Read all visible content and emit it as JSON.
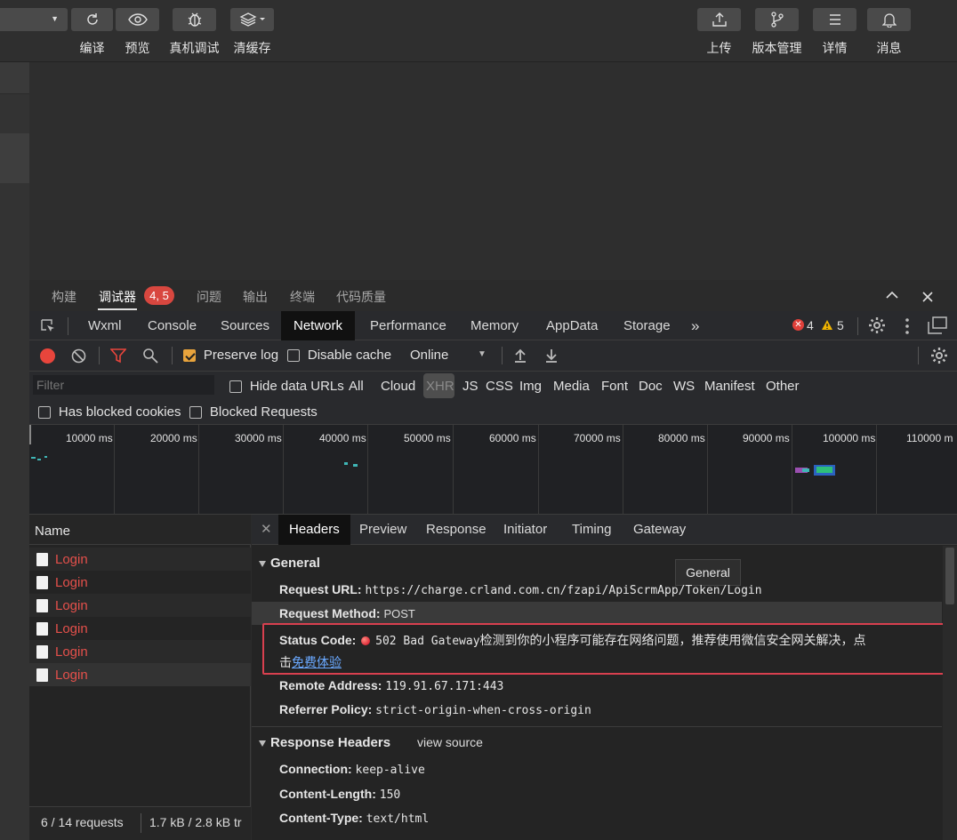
{
  "toolbar": {
    "left_buttons": [
      {
        "label": "编译",
        "icon": "refresh-icon"
      },
      {
        "label": "预览",
        "icon": "eye-icon"
      },
      {
        "label": "真机调试",
        "icon": "bug-icon"
      },
      {
        "label": "清缓存",
        "icon": "layers-icon"
      }
    ],
    "right_buttons": [
      {
        "label": "上传",
        "icon": "upload-icon"
      },
      {
        "label": "版本管理",
        "icon": "branch-icon"
      },
      {
        "label": "详情",
        "icon": "menu-icon"
      },
      {
        "label": "消息",
        "icon": "bell-icon"
      }
    ]
  },
  "debug_tabs": {
    "items": [
      "构建",
      "调试器",
      "问题",
      "输出",
      "终端",
      "代码质量"
    ],
    "active": "调试器",
    "badge": "4, 5"
  },
  "devtools_tabs": {
    "items": [
      "Wxml",
      "Console",
      "Sources",
      "Network",
      "Performance",
      "Memory",
      "AppData",
      "Storage"
    ],
    "active": "Network",
    "more": "»",
    "error_count": "4",
    "warning_count": "5"
  },
  "network_bar": {
    "preserve_log": "Preserve log",
    "disable_cache": "Disable cache",
    "throttle": "Online"
  },
  "filter": {
    "placeholder": "Filter",
    "hide_data_urls": "Hide data URLs",
    "types": [
      "All",
      "Cloud",
      "XHR",
      "JS",
      "CSS",
      "Img",
      "Media",
      "Font",
      "Doc",
      "WS",
      "Manifest",
      "Other"
    ],
    "active_type": "XHR",
    "has_blocked_cookies": "Has blocked cookies",
    "blocked_requests": "Blocked Requests"
  },
  "overview": {
    "ticks": [
      "10000 ms",
      "20000 ms",
      "30000 ms",
      "40000 ms",
      "50000 ms",
      "60000 ms",
      "70000 ms",
      "80000 ms",
      "90000 ms",
      "100000 ms",
      "110000 m"
    ]
  },
  "request_list": {
    "header": "Name",
    "rows": [
      "Login",
      "Login",
      "Login",
      "Login",
      "Login",
      "Login"
    ],
    "footer_count": "6 / 14 requests",
    "footer_size": "1.7 kB / 2.8 kB tr"
  },
  "detail": {
    "tabs": [
      "Headers",
      "Preview",
      "Response",
      "Initiator",
      "Timing",
      "Gateway"
    ],
    "active_tab": "Headers",
    "tooltip": "General",
    "general_title": "General",
    "request_url_key": "Request URL:",
    "request_url": "https://charge.crland.com.cn/fzapi/ApiScrmApp/Token/Login",
    "request_method_key": "Request Method:",
    "request_method": "POST",
    "status_code_key": "Status Code:",
    "status_code": "502 Bad Gateway",
    "status_note": "检测到你的小程序可能存在网络问题，推荐使用微信安全网关解决，点",
    "status_note2": "击",
    "status_link": "免费体验",
    "remote_address_key": "Remote Address:",
    "remote_address": "119.91.67.171:443",
    "referrer_policy_key": "Referrer Policy:",
    "referrer_policy": "strict-origin-when-cross-origin",
    "response_headers_title": "Response Headers",
    "view_source": "view source",
    "connection_key": "Connection:",
    "connection": "keep-alive",
    "content_length_key": "Content-Length:",
    "content_length": "150",
    "content_type_key": "Content-Type:",
    "content_type": "text/html"
  }
}
